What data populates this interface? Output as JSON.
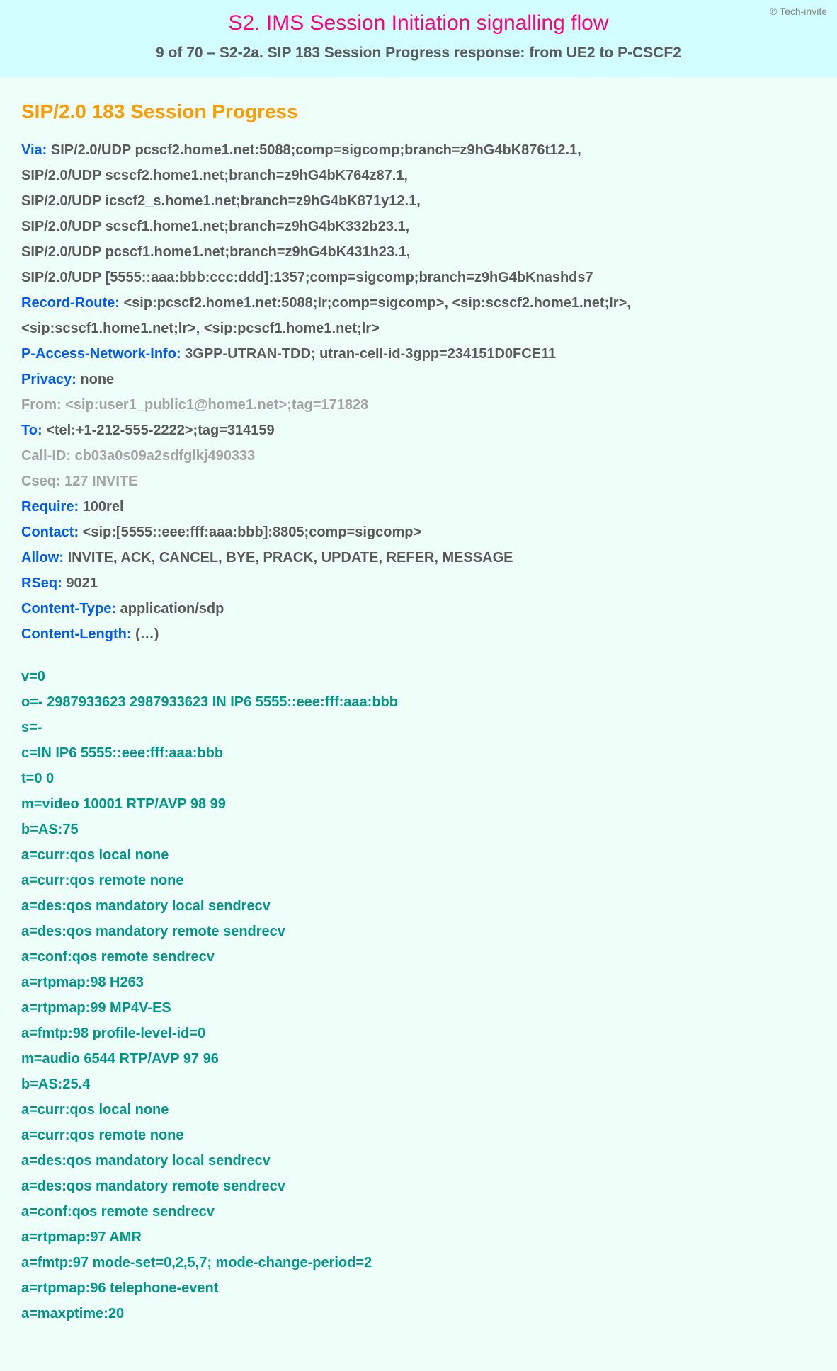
{
  "header": {
    "copyright": "© Tech-invite",
    "title": "S2. IMS Session Initiation signalling flow",
    "subtitle": "9 of 70 – S2-2a. SIP 183 Session Progress response: from UE2 to P-CSCF2"
  },
  "sip": {
    "status_line": "SIP/2.0 183 Session Progress",
    "via": {
      "name": "Via",
      "values": [
        "SIP/2.0/UDP pcscf2.home1.net:5088;comp=sigcomp;branch=z9hG4bK876t12.1,",
        "SIP/2.0/UDP scscf2.home1.net;branch=z9hG4bK764z87.1,",
        "SIP/2.0/UDP icscf2_s.home1.net;branch=z9hG4bK871y12.1,",
        "SIP/2.0/UDP scscf1.home1.net;branch=z9hG4bK332b23.1,",
        "SIP/2.0/UDP pcscf1.home1.net;branch=z9hG4bK431h23.1,",
        "SIP/2.0/UDP [5555::aaa:bbb:ccc:ddd]:1357;comp=sigcomp;branch=z9hG4bKnashds7"
      ]
    },
    "record_route": {
      "name": "Record-Route",
      "values": [
        "<sip:pcscf2.home1.net:5088;lr;comp=sigcomp>, <sip:scscf2.home1.net;lr>,",
        "<sip:scscf1.home1.net;lr>, <sip:pcscf1.home1.net;lr>"
      ]
    },
    "pani": {
      "name": "P-Access-Network-Info",
      "value": "3GPP-UTRAN-TDD; utran-cell-id-3gpp=234151D0FCE11"
    },
    "privacy": {
      "name": "Privacy",
      "value": "none"
    },
    "from": {
      "name": "From",
      "value": "<sip:user1_public1@home1.net>;tag=171828"
    },
    "to": {
      "name": "To",
      "value": "<tel:+1-212-555-2222>;tag=314159"
    },
    "call_id": {
      "name": "Call-ID",
      "value": "cb03a0s09a2sdfglkj490333"
    },
    "cseq": {
      "name": "Cseq",
      "value": "127 INVITE"
    },
    "require": {
      "name": "Require",
      "value": "100rel"
    },
    "contact": {
      "name": "Contact",
      "value": "<sip:[5555::eee:fff:aaa:bbb]:8805;comp=sigcomp>"
    },
    "allow": {
      "name": "Allow",
      "value": "INVITE, ACK, CANCEL, BYE, PRACK, UPDATE, REFER, MESSAGE"
    },
    "rseq": {
      "name": "RSeq",
      "value": "9021"
    },
    "ctype": {
      "name": "Content-Type",
      "value": "application/sdp"
    },
    "clen": {
      "name": "Content-Length",
      "value": "(…)"
    }
  },
  "sdp": [
    "v=0",
    "o=- 2987933623 2987933623 IN IP6 5555::eee:fff:aaa:bbb",
    "s=-",
    "c=IN IP6 5555::eee:fff:aaa:bbb",
    "t=0 0",
    "m=video 10001 RTP/AVP 98 99",
    "b=AS:75",
    "a=curr:qos local none",
    "a=curr:qos remote none",
    "a=des:qos mandatory local sendrecv",
    "a=des:qos mandatory remote sendrecv",
    "a=conf:qos remote sendrecv",
    "a=rtpmap:98 H263",
    "a=rtpmap:99 MP4V-ES",
    "a=fmtp:98 profile-level-id=0",
    "m=audio 6544 RTP/AVP 97 96",
    "b=AS:25.4",
    "a=curr:qos local none",
    "a=curr:qos remote none",
    "a=des:qos mandatory local sendrecv",
    "a=des:qos mandatory remote sendrecv",
    "a=conf:qos remote sendrecv",
    "a=rtpmap:97 AMR",
    "a=fmtp:97 mode-set=0,2,5,7; mode-change-period=2",
    "a=rtpmap:96 telephone-event",
    "a=maxptime:20"
  ]
}
